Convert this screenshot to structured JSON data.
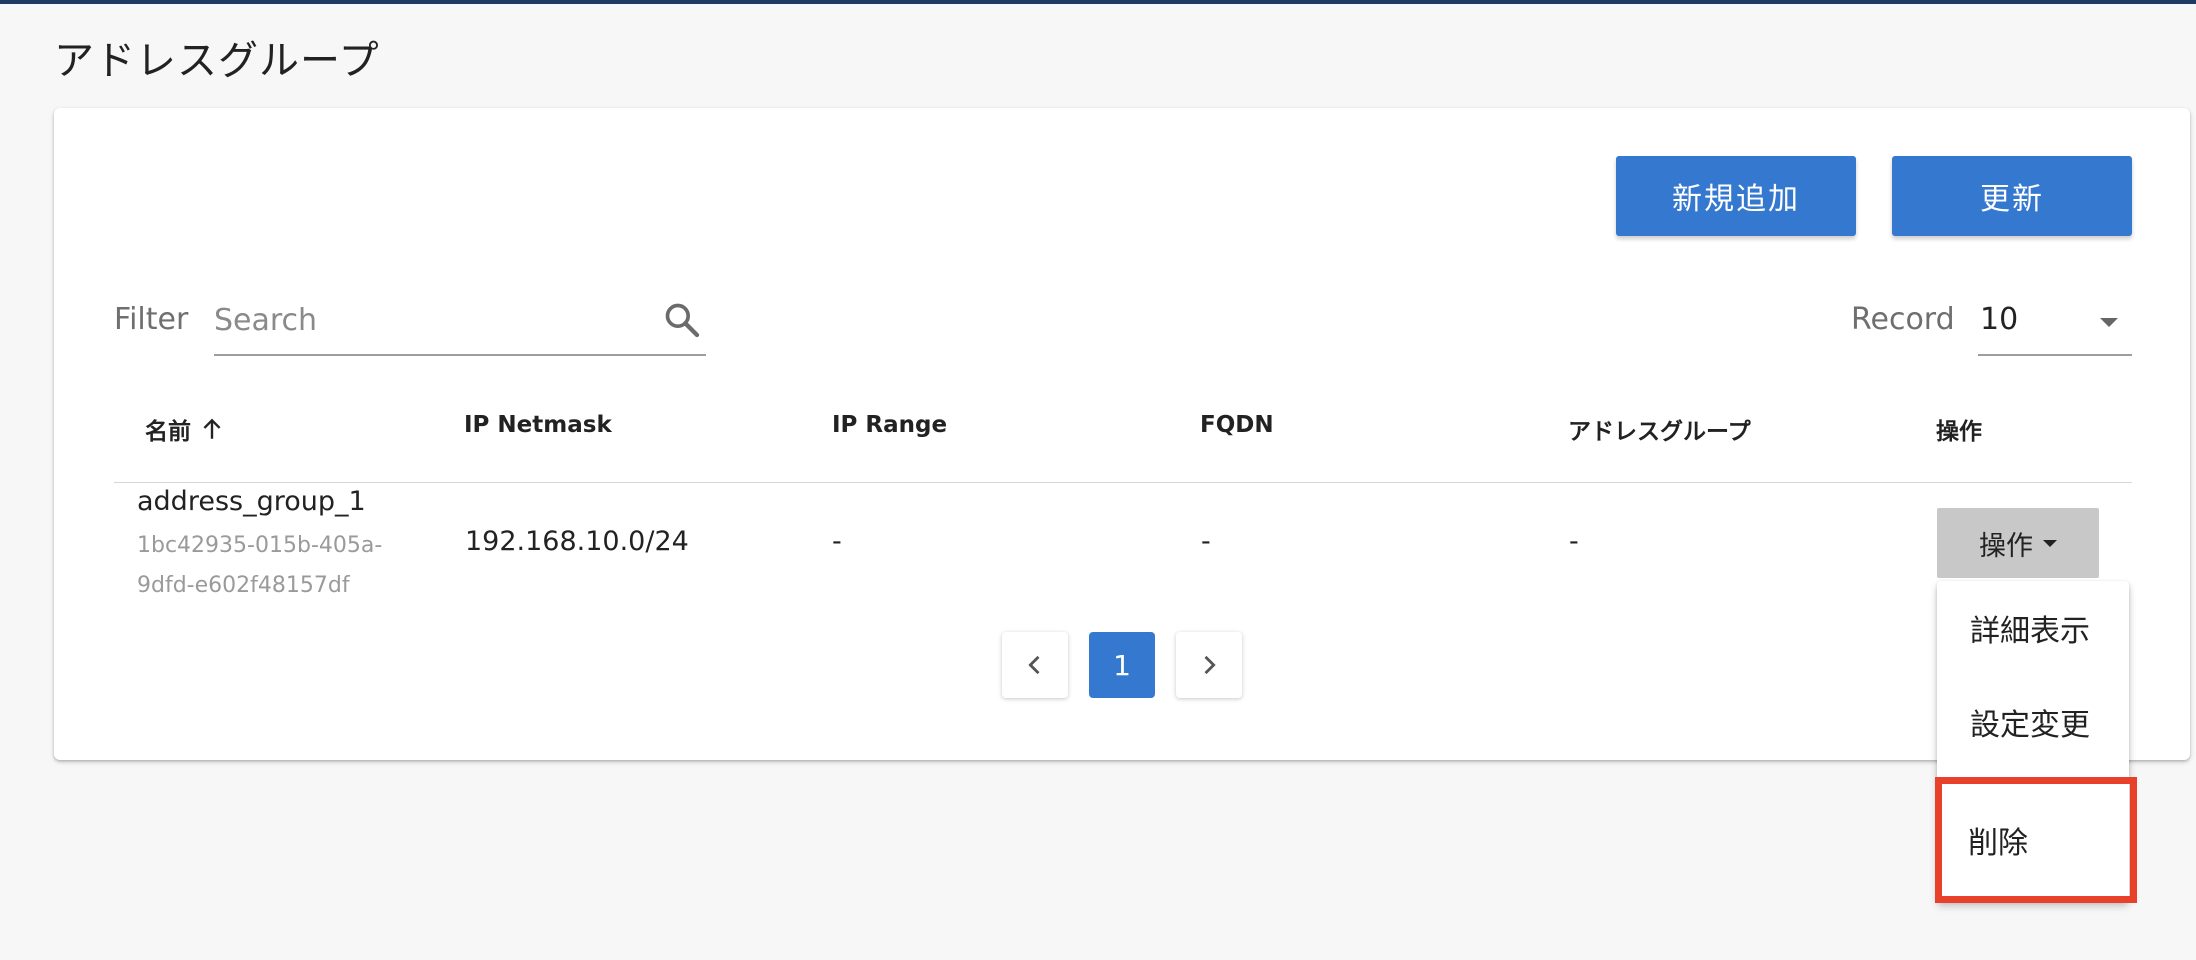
{
  "page": {
    "title": "アドレスグループ"
  },
  "toolbar": {
    "add_label": "新規追加",
    "refresh_label": "更新"
  },
  "filter": {
    "label": "Filter",
    "placeholder": "Search"
  },
  "record": {
    "label": "Record",
    "value": "10"
  },
  "table": {
    "columns": [
      "名前",
      "IP Netmask",
      "IP Range",
      "FQDN",
      "アドレスグループ",
      "操作"
    ],
    "sort": "ascending",
    "rows": [
      {
        "name": "address_group_1",
        "id_line1": "1bc42935-015b-405a-",
        "id_line2": "9dfd-e602f48157df",
        "ip_netmask": "192.168.10.0/24",
        "ip_range": "-",
        "fqdn": "-",
        "address_group": "-",
        "action_label": "操作"
      }
    ]
  },
  "pagination": {
    "current_page": "1"
  },
  "action_menu": {
    "items": [
      "詳細表示",
      "設定変更",
      "削除"
    ],
    "highlighted_index": 2,
    "highlight_color": "#e8402b"
  },
  "colors": {
    "primary": "#3478d0",
    "topbar": "#1e3a63"
  }
}
